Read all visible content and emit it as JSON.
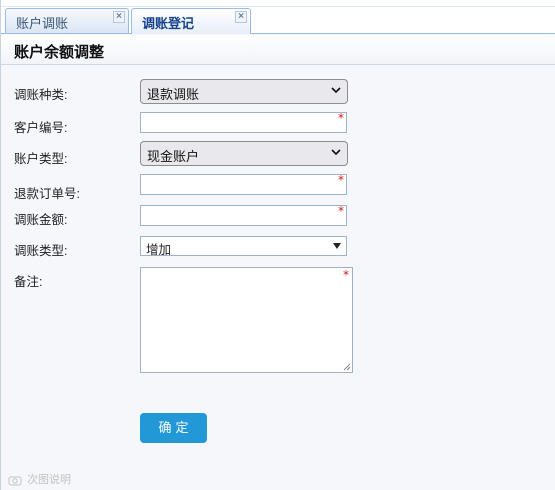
{
  "tabs": [
    {
      "label": "账户调账",
      "active": false,
      "close": "×"
    },
    {
      "label": "调账登记",
      "active": true,
      "close": "×"
    }
  ],
  "panel": {
    "title": "账户余额调整"
  },
  "form": {
    "adjust_kind": {
      "label": "调账种类:",
      "value": "退款调账"
    },
    "customer_no": {
      "label": "客户编号:",
      "value": "",
      "required": "*"
    },
    "account_type": {
      "label": "账户类型:",
      "value": "现金账户"
    },
    "refund_order_no": {
      "label": "退款订单号:",
      "value": "",
      "required": "*"
    },
    "adjust_amount": {
      "label": "调账金额:",
      "value": "",
      "required": "*"
    },
    "adjust_type": {
      "label": "调账类型:",
      "value": "增加"
    },
    "remark": {
      "label": "备注:",
      "value": "",
      "required": "*"
    }
  },
  "submit": {
    "label": "确定"
  },
  "watermark": {
    "text": "次图说明"
  },
  "colors": {
    "tab_border": "#99bbe8",
    "button": "#2299d6",
    "required": "#d21a1a",
    "active_tab_text": "#15428b"
  }
}
